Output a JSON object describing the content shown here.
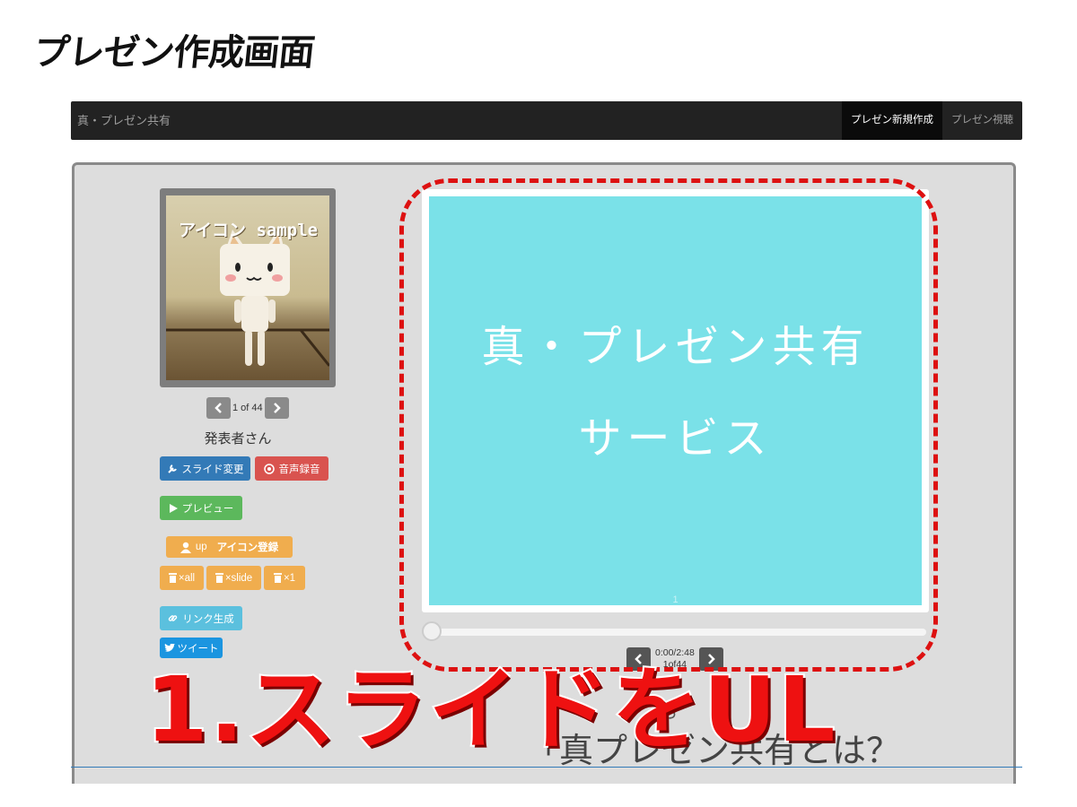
{
  "page_heading": "プレゼン作成画面",
  "navbar": {
    "brand": "真・プレゼン共有",
    "items": [
      {
        "label": "プレゼン新規作成",
        "active": true
      },
      {
        "label": "プレゼン視聴",
        "active": false
      }
    ]
  },
  "sidebar": {
    "icon_caption": "アイコン sample",
    "icon_pager": {
      "prev_icon": "chevron-left-icon",
      "text": "1 of 44",
      "next_icon": "chevron-right-icon"
    },
    "presenter_name": "発表者さん",
    "buttons": {
      "slide_change": "スライド変更",
      "record_audio": "音声録音",
      "preview": "プレビュー",
      "icon_upload_prefix": "up",
      "icon_register": "アイコン登録",
      "delete_all": "×all",
      "delete_slide": "×slide",
      "delete_one": "×1",
      "link_generate": "リンク生成",
      "tweet": "ツイート"
    }
  },
  "main": {
    "slide": {
      "line1": "真・プレゼン共有",
      "line2": "サービス",
      "number": "1"
    },
    "playback": {
      "time": "0:00/2:48",
      "page": "1of44",
      "progress": 0
    },
    "background_text": {
      "small": "お",
      "large": "「真プレゼン共有とは？"
    }
  },
  "overlay_caption": "1.スライドをUL",
  "colors": {
    "navbar": "#222222",
    "slide_bg": "#7ae1e8",
    "annotation_red": "#dd1111",
    "btn_blue": "#337ab7",
    "btn_red": "#d9534f",
    "btn_green": "#5cb85c",
    "btn_orange": "#f0ad4e",
    "btn_cyan": "#5bc0de"
  }
}
